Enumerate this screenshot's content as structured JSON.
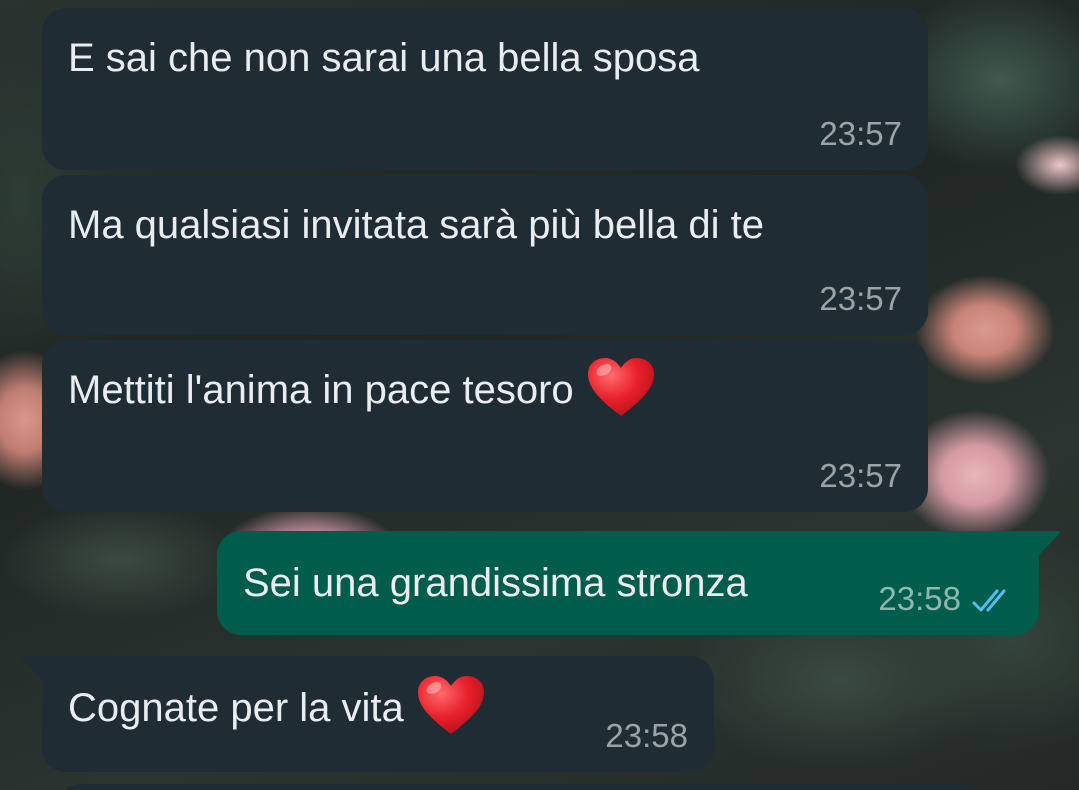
{
  "messages": [
    {
      "direction": "incoming",
      "text": "E sai che non sarai una bella sposa",
      "time": "23:57"
    },
    {
      "direction": "incoming",
      "text": "Ma qualsiasi invitata sarà più bella di te",
      "time": "23:57"
    },
    {
      "direction": "incoming",
      "text": "Mettiti l'anima in pace tesoro",
      "emoji": "red-heart-icon",
      "time": "23:57"
    },
    {
      "direction": "outgoing",
      "text": "Sei una grandissima stronza",
      "time": "23:58",
      "status": "read",
      "status_icon": "double-check-icon"
    },
    {
      "direction": "incoming",
      "text": "Cognate per la vita",
      "emoji": "red-heart-icon",
      "time": "23:58"
    }
  ],
  "colors": {
    "incoming_bubble": "#1f2c34",
    "outgoing_bubble": "#005c4b",
    "text": "#e9edef",
    "read_ticks": "#53bdeb",
    "heart": "#e8202b"
  }
}
